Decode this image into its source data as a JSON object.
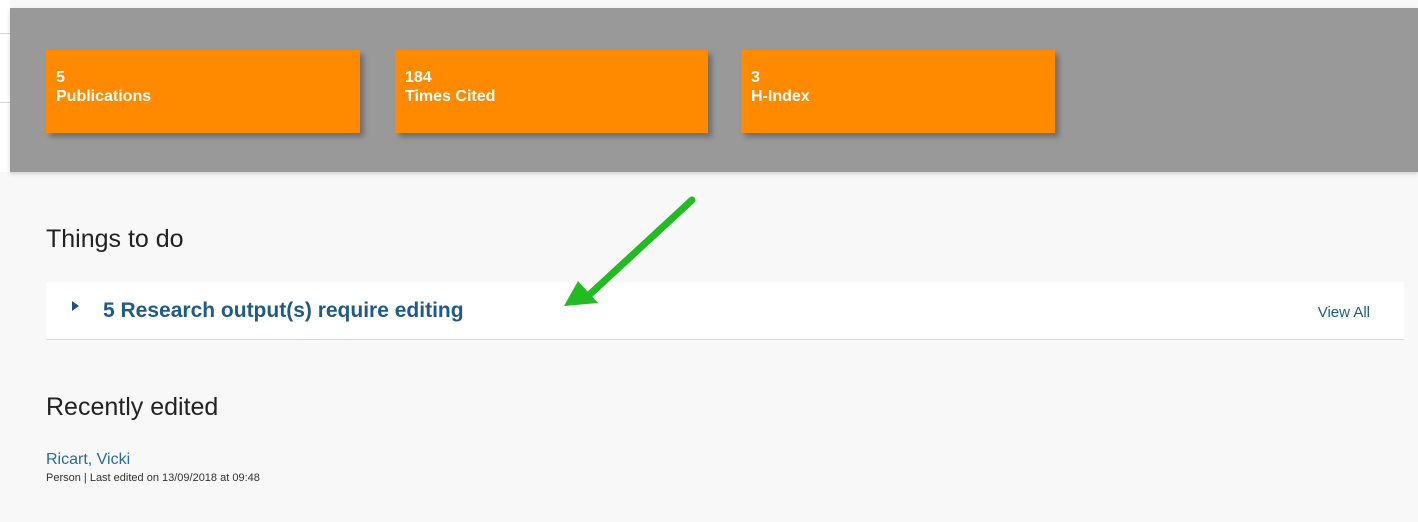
{
  "metrics": [
    {
      "value": "5",
      "label": "Publications"
    },
    {
      "value": "184",
      "label": "Times Cited"
    },
    {
      "value": "3",
      "label": "H-Index"
    }
  ],
  "things_to_do": {
    "heading": "Things to do",
    "item_text": "5 Research output(s) require editing",
    "view_all": "View All"
  },
  "recently_edited": {
    "heading": "Recently edited",
    "name": "Ricart, Vicki",
    "meta": "Person | Last edited on 13/09/2018 at 09:48"
  },
  "colors": {
    "metric_card": "#ff8a00",
    "metrics_band": "#999999",
    "link": "#1e5b87",
    "annotation_arrow": "#22bb22"
  },
  "icons": {
    "toggle": "caret-right-icon",
    "annotation": "green-arrow-icon"
  }
}
